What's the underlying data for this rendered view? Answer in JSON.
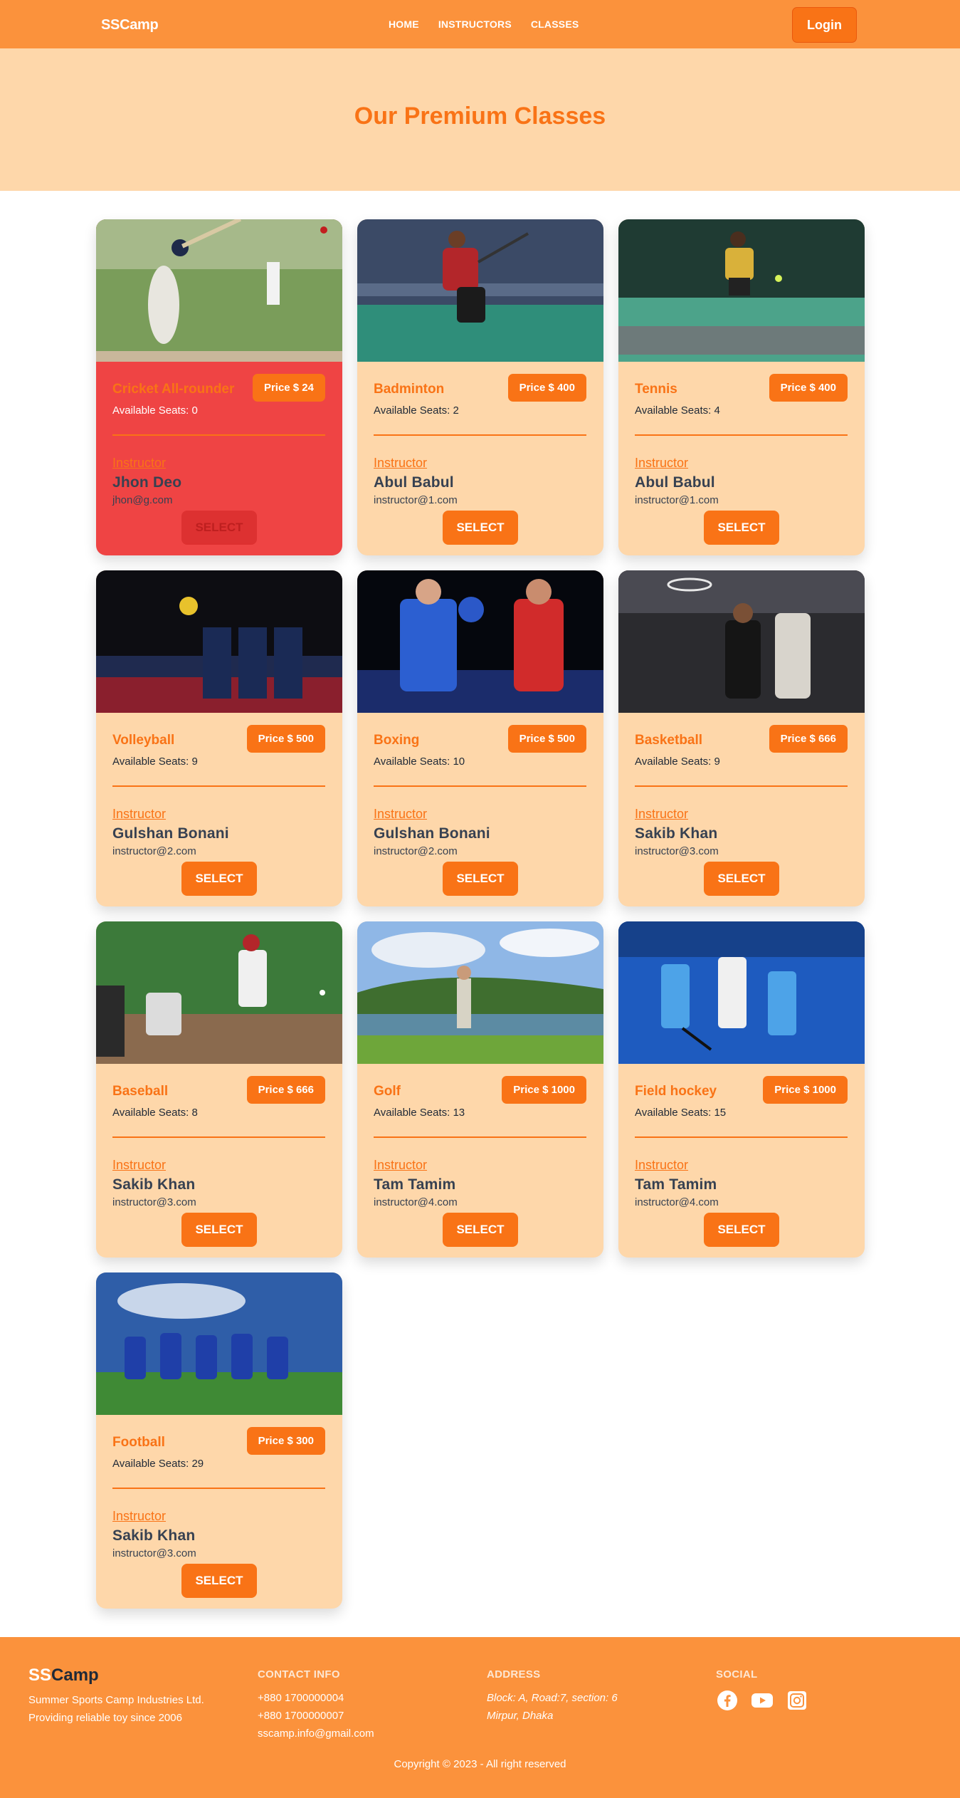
{
  "navbar": {
    "brand_ss": "SS",
    "brand_camp": "Camp",
    "links": [
      "HOME",
      "INSTRUCTORS",
      "CLASSES"
    ],
    "login_label": "Login"
  },
  "hero": {
    "title": "Our Premium Classes"
  },
  "classes": [
    {
      "name": "Cricket All-rounder",
      "price": "Price $ 24",
      "seats": "Available Seats: 0",
      "instructor_label": "Instructor",
      "instructor": "Jhon Deo",
      "email": "jhon@g.com",
      "button": "SELECT",
      "sold_out": true,
      "image": "cricket-photo"
    },
    {
      "name": "Badminton",
      "price": "Price $ 400",
      "seats": "Available Seats: 2",
      "instructor_label": "Instructor",
      "instructor": "Abul Babul",
      "email": "instructor@1.com",
      "button": "SELECT",
      "sold_out": false,
      "image": "badminton-photo"
    },
    {
      "name": "Tennis",
      "price": "Price $ 400",
      "seats": "Available Seats: 4",
      "instructor_label": "Instructor",
      "instructor": "Abul Babul",
      "email": "instructor@1.com",
      "button": "SELECT",
      "sold_out": false,
      "image": "tennis-photo"
    },
    {
      "name": "Volleyball",
      "price": "Price $ 500",
      "seats": "Available Seats: 9",
      "instructor_label": "Instructor",
      "instructor": "Gulshan Bonani",
      "email": "instructor@2.com",
      "button": "SELECT",
      "sold_out": false,
      "image": "volleyball-photo"
    },
    {
      "name": "Boxing",
      "price": "Price $ 500",
      "seats": "Available Seats: 10",
      "instructor_label": "Instructor",
      "instructor": "Gulshan Bonani",
      "email": "instructor@2.com",
      "button": "SELECT",
      "sold_out": false,
      "image": "boxing-photo"
    },
    {
      "name": "Basketball",
      "price": "Price $ 666",
      "seats": "Available Seats: 9",
      "instructor_label": "Instructor",
      "instructor": "Sakib Khan",
      "email": "instructor@3.com",
      "button": "SELECT",
      "sold_out": false,
      "image": "basketball-photo"
    },
    {
      "name": "Baseball",
      "price": "Price $ 666",
      "seats": "Available Seats: 8",
      "instructor_label": "Instructor",
      "instructor": "Sakib Khan",
      "email": "instructor@3.com",
      "button": "SELECT",
      "sold_out": false,
      "image": "baseball-photo"
    },
    {
      "name": "Golf",
      "price": "Price $ 1000",
      "seats": "Available Seats: 13",
      "instructor_label": "Instructor",
      "instructor": "Tam Tamim",
      "email": "instructor@4.com",
      "button": "SELECT",
      "sold_out": false,
      "image": "golf-photo"
    },
    {
      "name": "Field hockey",
      "price": "Price $ 1000",
      "seats": "Available Seats: 15",
      "instructor_label": "Instructor",
      "instructor": "Tam Tamim",
      "email": "instructor@4.com",
      "button": "SELECT",
      "sold_out": false,
      "image": "field-hockey-photo"
    },
    {
      "name": "Football",
      "price": "Price $ 300",
      "seats": "Available Seats: 29",
      "instructor_label": "Instructor",
      "instructor": "Sakib Khan",
      "email": "instructor@3.com",
      "button": "SELECT",
      "sold_out": false,
      "image": "football-photo"
    }
  ],
  "footer": {
    "brand_ss": "SS",
    "brand_camp": "Camp",
    "tagline_1": "Summer Sports Camp Industries Ltd.",
    "tagline_2": "Providing reliable toy since 2006",
    "contact_heading": "CONTACT INFO",
    "phone_1": "+880 1700000004",
    "phone_2": "+880 1700000007",
    "email": "sscamp.info@gmail.com",
    "address_heading": "ADDRESS",
    "address_1": "Block: A, Road:7, section: 6",
    "address_2": "Mirpur, Dhaka",
    "social_heading": "SOCIAL",
    "social_icons": [
      "facebook-icon",
      "youtube-icon",
      "instagram-icon"
    ],
    "copyright": "Copyright © 2023 - All right reserved"
  },
  "colors": {
    "navbar": "#fb923c",
    "accent": "#f97316",
    "card_bg": "#fed7aa",
    "sold_out_bg": "#ef4444"
  }
}
